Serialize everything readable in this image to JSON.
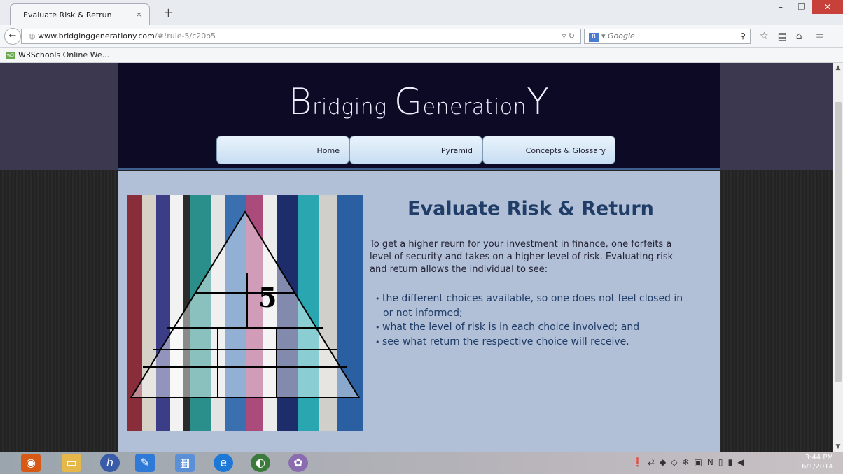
{
  "browser": {
    "tab_title": "Evaluate Risk & Retrun",
    "new_tab_label": "+",
    "url_domain": "www.bridginggenerationy.com",
    "url_path": "/#!rule-5/c20o5",
    "search_engine_icon": "8",
    "search_placeholder": "Google",
    "bookmark_label": "W3Schools Online We..."
  },
  "site": {
    "logo_B": "B",
    "logo_ridging": "ridging ",
    "logo_G": "G",
    "logo_eneration": "eneration",
    "logo_Y": "Y",
    "nav": [
      "Home",
      "Pyramid",
      "Concepts & Glossary"
    ]
  },
  "page": {
    "title": "Evaluate Risk & Return",
    "intro": "To get a higher reurn for your investment in finance, one forfeits a level of security and takes on a higher level of risk. Evaluating risk and return allows the individual to see:",
    "bullets": [
      "the different choices available, so one does not feel closed in or not informed;",
      "what the level of risk is in each choice involved; and",
      "see what return the respective choice will receive."
    ],
    "pyramid_number": "5"
  },
  "taskbar": {
    "time": "3:44 PM",
    "date": "6/1/2014"
  },
  "colors": {
    "header_bg": "#0c0a24",
    "content_bg": "#b1bfd7",
    "title_color": "#1f3d67"
  }
}
